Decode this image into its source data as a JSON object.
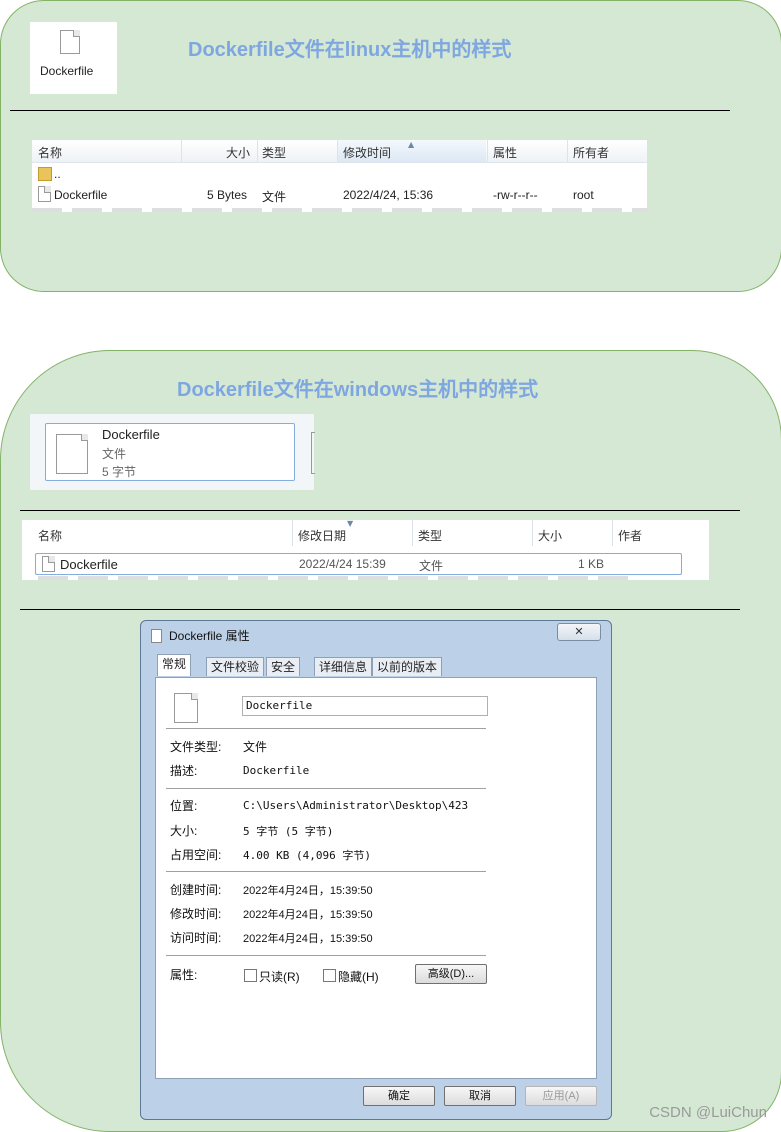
{
  "linux_section": {
    "title": "Dockerfile文件在linux主机中的样式",
    "icon_label": "Dockerfile",
    "columns": [
      "名称",
      "大小",
      "类型",
      "修改时间",
      "属性",
      "所有者"
    ],
    "parent_row": "..",
    "row": {
      "name": "Dockerfile",
      "size": "5 Bytes",
      "type": "文件",
      "modified": "2022/4/24, 15:36",
      "attrs": "-rw-r--r--",
      "owner": "root"
    }
  },
  "windows_section": {
    "title": "Dockerfile文件在windows主机中的样式",
    "tile": {
      "name": "Dockerfile",
      "type": "文件",
      "size": "5 字节"
    },
    "columns": [
      "名称",
      "修改日期",
      "类型",
      "大小",
      "作者"
    ],
    "row": {
      "name": "Dockerfile",
      "modified": "2022/4/24 15:39",
      "type": "文件",
      "size": "1 KB"
    }
  },
  "dialog": {
    "title": "Dockerfile 属性",
    "close": "✕",
    "tabs": [
      "常规",
      "文件校验",
      "安全",
      "详细信息",
      "以前的版本"
    ],
    "filename": "Dockerfile",
    "labels": {
      "file_type": "文件类型:",
      "desc": "描述:",
      "location": "位置:",
      "size": "大小:",
      "disk": "占用空间:",
      "created": "创建时间:",
      "modified": "修改时间:",
      "accessed": "访问时间:",
      "attributes": "属性:"
    },
    "values": {
      "file_type": "文件",
      "desc": "Dockerfile",
      "location": "C:\\Users\\Administrator\\Desktop\\423",
      "size": "5 字节 (5 字节)",
      "disk": "4.00 KB (4,096 字节)",
      "created": "2022年4月24日，15:39:50",
      "modified": "2022年4月24日，15:39:50",
      "accessed": "2022年4月24日，15:39:50"
    },
    "readonly": "只读(R)",
    "hidden": "隐藏(H)",
    "advanced": "高级(D)...",
    "ok": "确定",
    "cancel": "取消",
    "apply": "应用(A)"
  },
  "watermark": "CSDN @LuiChun"
}
